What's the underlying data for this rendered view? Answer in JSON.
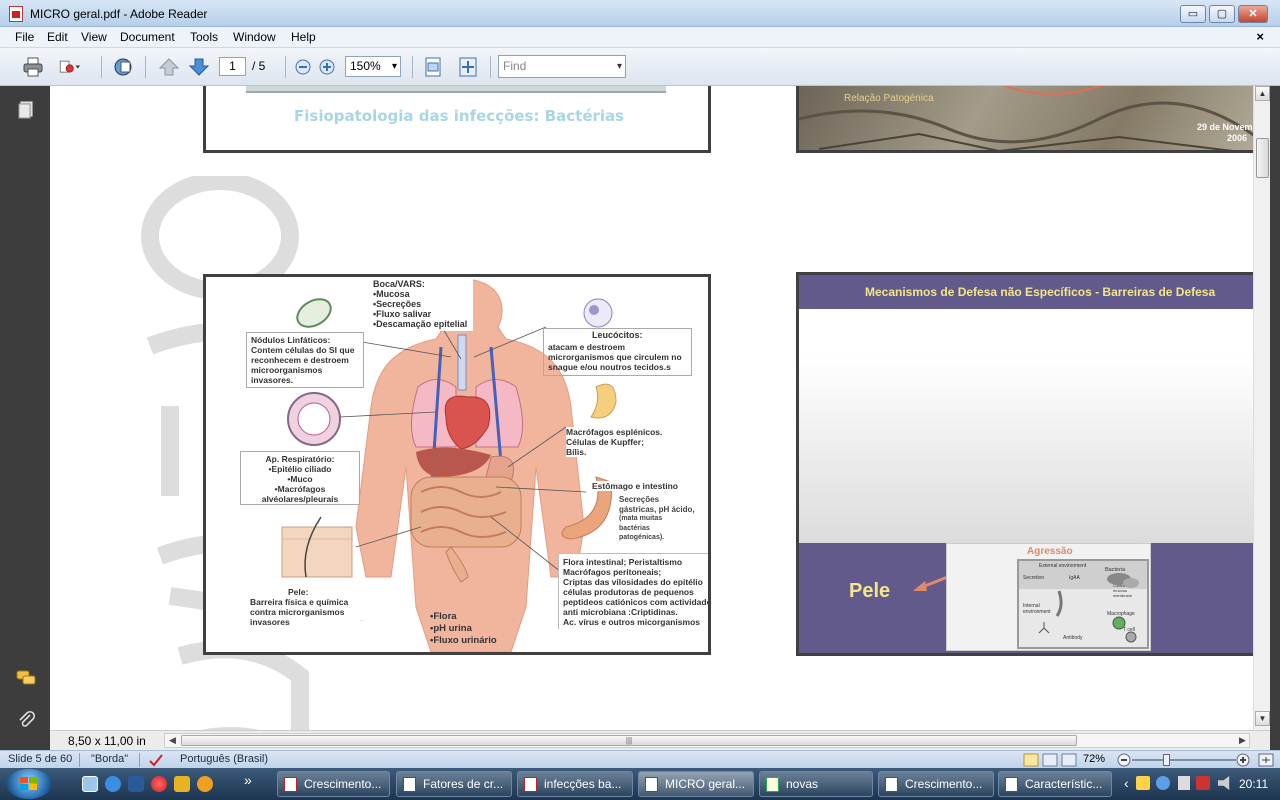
{
  "window": {
    "title": "MICRO geral.pdf - Adobe Reader",
    "min_glyph": "▭",
    "max_glyph": "▢",
    "close_glyph": "✕"
  },
  "menu": {
    "items": [
      "File",
      "Edit",
      "View",
      "Document",
      "Tools",
      "Window",
      "Help"
    ],
    "doc_close": "×"
  },
  "toolbar": {
    "page_current": "1",
    "page_total": "/ 5",
    "zoom": "150%",
    "find_placeholder": "Find"
  },
  "slide1": {
    "subtitle": "Fisiopatologia das infecções: Bactérias"
  },
  "slide2": {
    "caption": "Relação Patogénica",
    "date_line1": "29 de Novem",
    "date_line2": "2006"
  },
  "slide3": {
    "boca_title": "Boca/VARS:",
    "boca_items": [
      "•Mucosa",
      "•Secreções",
      "•Fluxo salivar",
      "•Descamação epitelial"
    ],
    "nodulos": [
      "Nódulos Linfáticos:",
      "Contem células do SI que",
      "reconhecem e destroem",
      "microorganismos",
      "invasores."
    ],
    "leucocitos_title": "Leucócitos:",
    "leucocitos": [
      "atacam e destroem",
      "microrganismos que circulem no",
      "snague e/ou noutros tecidos.s"
    ],
    "macrofagos": [
      "Macrófagos esplénicos.",
      "Células de Kupffer;",
      "Bílis."
    ],
    "respiratorio": [
      "Ap. Respiratório:",
      "•Epitélio ciliado",
      "•Muco",
      "•Macrófagos",
      "alvéolares/pleurais"
    ],
    "estomago": "Estômago e intestino",
    "secrecoes": [
      "Secreções",
      "gástricas, pH ácido,",
      "(mata muitas",
      "bactérias",
      "patogénicas)."
    ],
    "flora_intestinal": [
      "Flora intestinal; Peristaltismo",
      "Macrófagos peritoneais;",
      "Criptas das vilosidades do epitélio",
      "células produtoras de pequenos",
      "peptideos catiónicos com actividade",
      "anti microbiana :Criptidinas.",
      "Ac. vírus e outros micorganismos"
    ],
    "pele": [
      "Pele:",
      "Barreira física e química",
      "contra microrganismos",
      "invasores"
    ],
    "urina": [
      "•Flora",
      "•pH urina",
      "•Fluxo urinário"
    ],
    "tiny_left": "...",
    "tiny_right": "..."
  },
  "slide4": {
    "header": "Mecanismos de Defesa não Específicos - Barreiras de Defesa",
    "pele": "Pele",
    "agressao": "Agressão",
    "inset": {
      "external": "External environment",
      "bacteria": "Bacteria",
      "secretion": "Secretion",
      "igaa": "IgAA",
      "cutaneous": "Cutaneous or mucous membrane",
      "internal": "Internal environment",
      "macrophage": "Macrophage",
      "tcell": "T cell",
      "antibody": "Antibody"
    }
  },
  "reader_status": {
    "page_size": "8,50 x 11,00 in",
    "hscroll_grip": "|||"
  },
  "ppt_status": {
    "slide": "Slide 5 de 60",
    "theme": "\"Borda\"",
    "language": "Português (Brasil)",
    "zoom": "72%",
    "zoom_level_pct": 72
  },
  "taskbar": {
    "tasks": [
      {
        "label": "Crescimento..."
      },
      {
        "label": "Fatores de cr..."
      },
      {
        "label": "infecções ba..."
      },
      {
        "label": "MICRO geral..."
      },
      {
        "label": "novas"
      },
      {
        "label": "Crescimento..."
      },
      {
        "label": "Característic..."
      }
    ],
    "more": "»",
    "tray_arrow": "‹",
    "clock": "20:11"
  },
  "colors": {
    "slide4_purple": "#635a8c",
    "agressao": "#e08a6a",
    "slide1_subtitle": "#a9d6e5",
    "pele_text": "#f3e58a"
  }
}
